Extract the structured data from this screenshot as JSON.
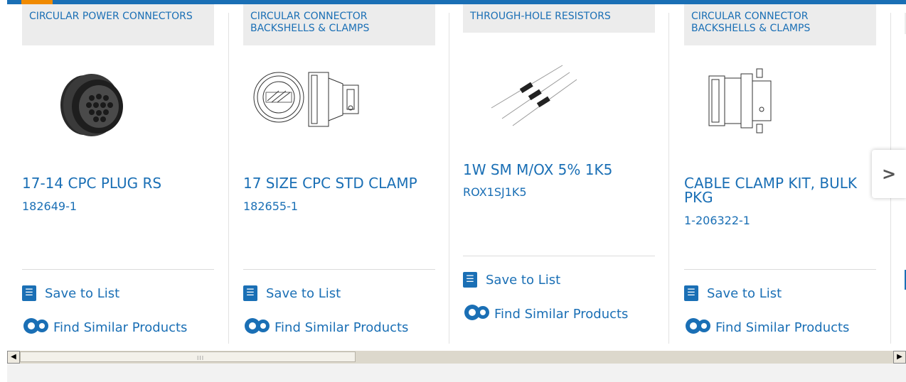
{
  "colors": {
    "brand_blue": "#1a6fb5",
    "accent_orange": "#f08a00",
    "category_bg": "#ececec"
  },
  "cards": [
    {
      "category": "CIRCULAR POWER CONNECTORS",
      "title": "17-14 CPC PLUG RS",
      "part": "182649-1",
      "save_label": "Save to List",
      "similar_label": "Find Similar Products",
      "image_icon": "circular-plug-photo"
    },
    {
      "category": "CIRCULAR CONNECTOR BACKSHELLS & CLAMPS",
      "title": "17 SIZE CPC STD CLAMP",
      "part": "182655-1",
      "save_label": "Save to List",
      "similar_label": "Find Similar Products",
      "image_icon": "clamp-drawing"
    },
    {
      "category": "THROUGH-HOLE RESISTORS",
      "title": "1W SM M/OX 5% 1K5",
      "part": "ROX1SJ1K5",
      "save_label": "Save to List",
      "similar_label": "Find Similar Products",
      "image_icon": "resistor-photo"
    },
    {
      "category": "CIRCULAR CONNECTOR BACKSHELLS & CLAMPS",
      "title": "CABLE CLAMP KIT, BULK PKG",
      "part": "1-206322-1",
      "save_label": "Save to List",
      "similar_label": "Find Similar Products",
      "image_icon": "clamp-kit-drawing"
    }
  ],
  "next_button": {
    "icon": "chevron-right-icon",
    "glyph": ">"
  },
  "scrollbar": {
    "left_glyph": "◀",
    "right_glyph": "▶",
    "grip": "III"
  }
}
